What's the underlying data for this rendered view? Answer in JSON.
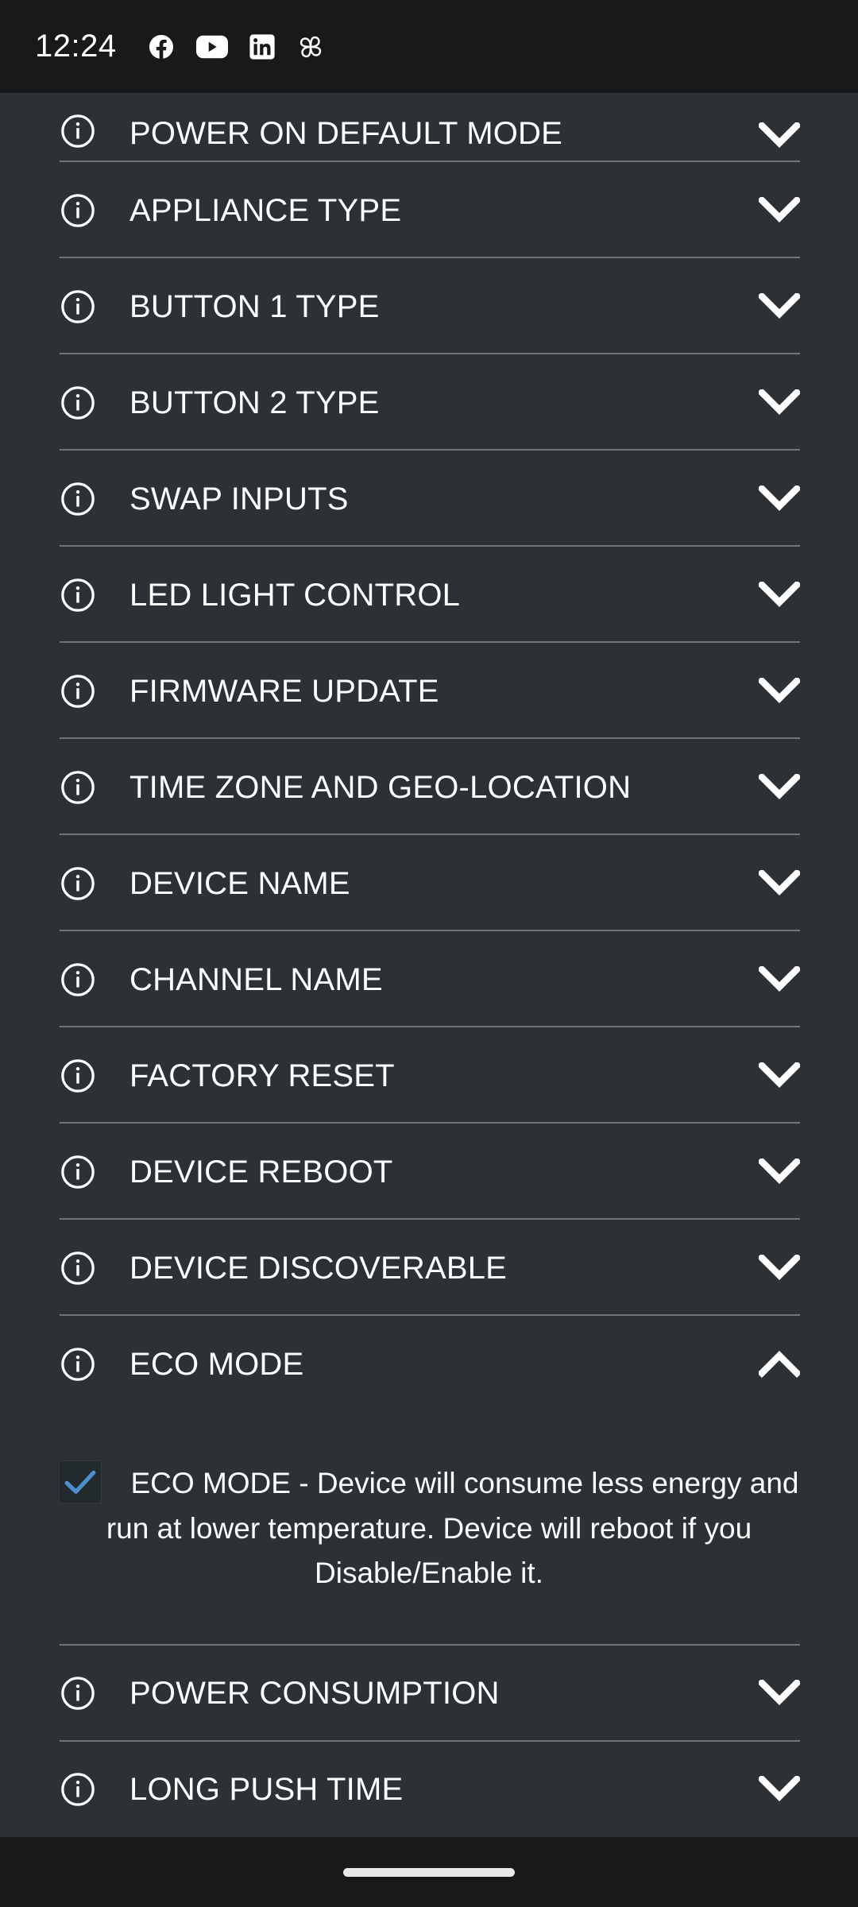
{
  "status_bar": {
    "time": "12:24",
    "icons": [
      {
        "name": "facebook-icon",
        "label": "Facebook"
      },
      {
        "name": "youtube-icon",
        "label": "YouTube"
      },
      {
        "name": "linkedin-icon",
        "label": "LinkedIn"
      },
      {
        "name": "pinwheel-icon",
        "label": "Pinwheel"
      }
    ]
  },
  "settings": {
    "rows": [
      {
        "label": "POWER ON DEFAULT MODE",
        "state": "collapsed",
        "chevron": "chevron-down-icon"
      },
      {
        "label": "APPLIANCE TYPE",
        "state": "collapsed",
        "chevron": "chevron-down-icon"
      },
      {
        "label": "BUTTON 1 TYPE",
        "state": "collapsed",
        "chevron": "chevron-down-icon"
      },
      {
        "label": "BUTTON 2 TYPE",
        "state": "collapsed",
        "chevron": "chevron-down-icon"
      },
      {
        "label": "SWAP INPUTS",
        "state": "collapsed",
        "chevron": "chevron-down-icon"
      },
      {
        "label": "LED LIGHT CONTROL",
        "state": "collapsed",
        "chevron": "chevron-down-icon"
      },
      {
        "label": "FIRMWARE UPDATE",
        "state": "collapsed",
        "chevron": "chevron-down-icon"
      },
      {
        "label": "TIME ZONE AND GEO-LOCATION",
        "state": "collapsed",
        "chevron": "chevron-down-icon"
      },
      {
        "label": "DEVICE NAME",
        "state": "collapsed",
        "chevron": "chevron-down-icon"
      },
      {
        "label": "CHANNEL NAME",
        "state": "collapsed",
        "chevron": "chevron-down-icon"
      },
      {
        "label": "FACTORY RESET",
        "state": "collapsed",
        "chevron": "chevron-down-icon"
      },
      {
        "label": "DEVICE REBOOT",
        "state": "collapsed",
        "chevron": "chevron-down-icon"
      },
      {
        "label": "DEVICE DISCOVERABLE",
        "state": "collapsed",
        "chevron": "chevron-down-icon"
      },
      {
        "label": "ECO MODE",
        "state": "expanded",
        "chevron": "chevron-up-icon"
      },
      {
        "label": "POWER CONSUMPTION",
        "state": "collapsed",
        "chevron": "chevron-down-icon"
      },
      {
        "label": "LONG PUSH TIME",
        "state": "collapsed",
        "chevron": "chevron-down-icon"
      }
    ]
  },
  "eco_mode_panel": {
    "checkbox_checked": true,
    "description": "ECO MODE - Device will consume less energy and run at lower temperature. Device will reboot if you Disable/Enable it."
  },
  "colors": {
    "page_background": "#2b3134",
    "status_bar_background": "#17191a",
    "divider": "#6f7578",
    "text_primary": "#ffffff",
    "checkbox_accent": "#4a90cf",
    "checkbox_fill": "#232a2d",
    "nav_pill": "#e9e9e7"
  }
}
